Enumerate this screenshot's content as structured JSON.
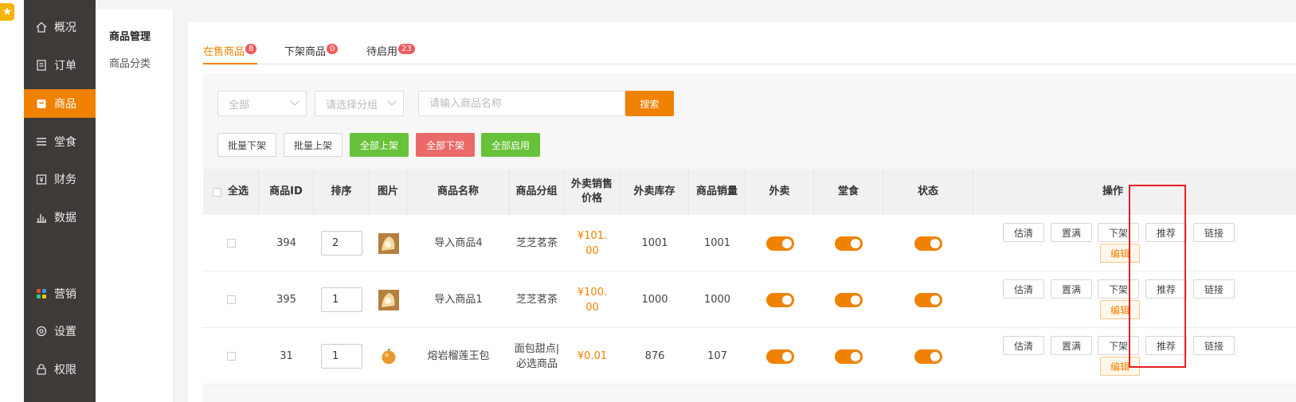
{
  "sidebar": {
    "items": [
      {
        "label": "概况",
        "icon": "home-icon"
      },
      {
        "label": "订单",
        "icon": "document-icon"
      },
      {
        "label": "商品",
        "icon": "shopping-bag-icon",
        "active": true
      },
      {
        "label": "堂食",
        "icon": "list-icon"
      },
      {
        "label": "财务",
        "icon": "finance-icon"
      },
      {
        "label": "数据",
        "icon": "bar-chart-icon"
      },
      {
        "label": "营销",
        "icon": "apps-icon"
      },
      {
        "label": "设置",
        "icon": "gear-icon"
      },
      {
        "label": "权限",
        "icon": "lock-icon"
      }
    ]
  },
  "subnav": {
    "title": "商品管理",
    "item": "商品分类"
  },
  "tabs": [
    {
      "label": "在售商品",
      "count": "8",
      "active": true
    },
    {
      "label": "下架商品",
      "count": "0"
    },
    {
      "label": "待启用",
      "count": "23"
    }
  ],
  "filters": {
    "status_select": "全部",
    "group_select": "请选择分组",
    "search_placeholder": "请输入商品名称",
    "search_button": "搜索"
  },
  "bulk_actions": {
    "batch_off": "批量下架",
    "batch_on": "批量上架",
    "all_on": "全部上架",
    "all_off": "全部下架",
    "all_enable": "全部启用"
  },
  "table": {
    "headers": {
      "select_all": "全选",
      "id": "商品ID",
      "sort": "排序",
      "image": "图片",
      "name": "商品名称",
      "group": "商品分组",
      "price_l1": "外卖销售",
      "price_l2": "价格",
      "stock": "外卖库存",
      "sales": "商品销量",
      "takeout": "外卖",
      "dinein": "堂食",
      "status": "状态",
      "actions": "操作"
    },
    "action_labels": {
      "sold_out": "估清",
      "refill": "置满",
      "off_shelf": "下架",
      "recommend": "推荐",
      "link": "链接",
      "edit": "编辑"
    },
    "rows": [
      {
        "id": "394",
        "sort": "2",
        "name": "导入商品4",
        "group_l1": "芝芝茗茶",
        "group_l2": "",
        "price_l1": "¥101.",
        "price_l2": "00",
        "stock": "1001",
        "sales": "1001",
        "takeout_on": true,
        "dinein_on": true,
        "status_on": true
      },
      {
        "id": "395",
        "sort": "1",
        "name": "导入商品1",
        "group_l1": "芝芝茗茶",
        "group_l2": "",
        "price_l1": "¥100.",
        "price_l2": "00",
        "stock": "1000",
        "sales": "1000",
        "takeout_on": true,
        "dinein_on": true,
        "status_on": true
      },
      {
        "id": "31",
        "sort": "1",
        "name": "熔岩榴莲王包",
        "group_l1": "面包甜点|",
        "group_l2": "必选商品",
        "price_l1": "¥0.01",
        "price_l2": "",
        "stock": "876",
        "sales": "107",
        "takeout_on": true,
        "dinein_on": true,
        "status_on": true
      }
    ]
  },
  "colors": {
    "accent": "#f08200",
    "sidebar_bg": "#3d3a37",
    "green": "#67c23a",
    "red": "#ea6a6a",
    "highlight_box": "#e52222"
  }
}
